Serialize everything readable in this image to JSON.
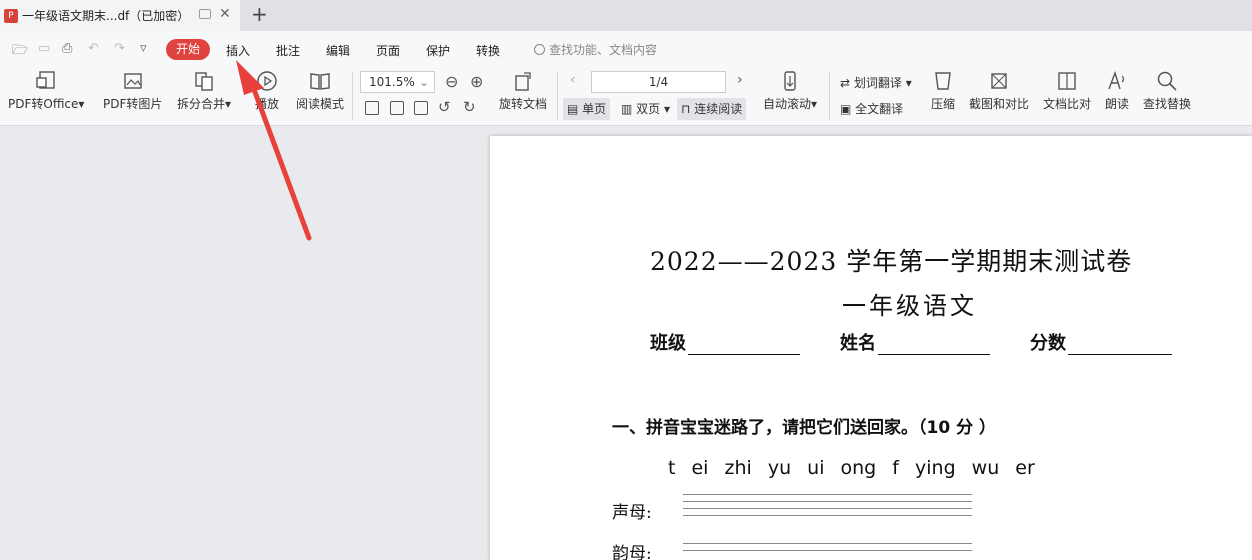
{
  "tab": {
    "title": "一年级语文期末...df（已加密）",
    "new_tab_symbol": "+"
  },
  "menu": {
    "items": [
      "开始",
      "插入",
      "批注",
      "编辑",
      "页面",
      "保护",
      "转换"
    ],
    "search_placeholder": "查找功能、文档内容"
  },
  "ribbon": {
    "pdf_to_office": "PDF转Office",
    "pdf_to_image": "PDF转图片",
    "split_merge": "拆分合并",
    "play": "播放",
    "read_mode": "阅读模式",
    "zoom": "101.5%",
    "rotate": "旋转文档",
    "page_indicator": "1/4",
    "single_page": "单页",
    "double_page": "双页",
    "continuous": "连续阅读",
    "auto_scroll": "自动滚动",
    "word_translate": "划词翻译",
    "full_translate": "全文翻译",
    "compress": "压缩",
    "screenshot_compare": "截图和对比",
    "doc_compare": "文档比对",
    "read_aloud": "朗读",
    "find_replace": "查找替换"
  },
  "document": {
    "title": "2022——2023 学年第一学期期末测试卷",
    "subtitle": "一年级语文",
    "fields": {
      "class": "班级",
      "name": "姓名",
      "score": "分数"
    },
    "question1": "一、拼音宝宝迷路了，请把它们送回家。（10 分 ）",
    "pinyin": "t  ei  zhi  yu  ui  ong  f  ying  wu  er",
    "row1_label": "声母:",
    "row2_label": "韵母:"
  },
  "colors": {
    "accent": "#e0433f",
    "arrow": "#e8413c"
  }
}
